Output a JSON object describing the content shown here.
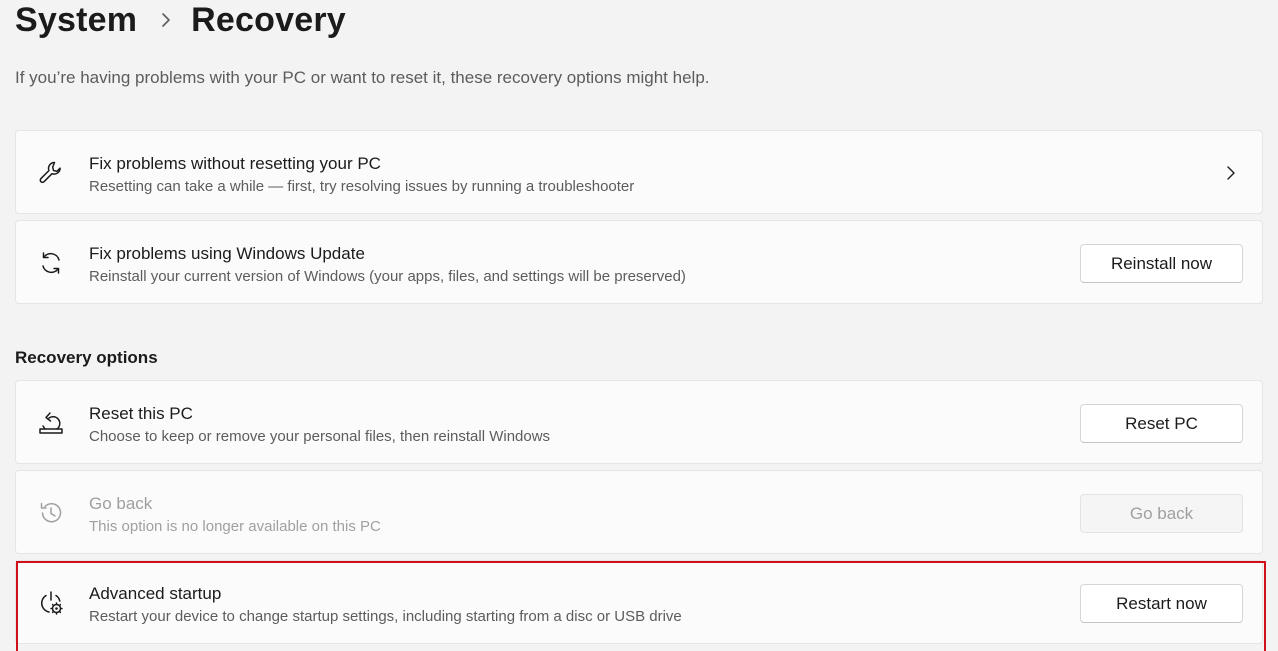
{
  "breadcrumb": {
    "parent": "System",
    "current": "Recovery"
  },
  "subtitle": "If you’re having problems with your PC or want to reset it, these recovery options might help.",
  "cards": [
    {
      "title": "Fix problems without resetting your PC",
      "description": "Resetting can take a while — first, try resolving issues by running a troubleshooter",
      "icon": "wrench-icon",
      "action": "chevron-right-icon"
    },
    {
      "title": "Fix problems using Windows Update",
      "description": "Reinstall your current version of Windows (your apps, files, and settings will be preserved)",
      "icon": "sync-icon",
      "button": "Reinstall now"
    }
  ],
  "recovery_options": {
    "heading": "Recovery options",
    "items": [
      {
        "title": "Reset this PC",
        "description": "Choose to keep or remove your personal files, then reinstall Windows",
        "icon": "reset-pc-icon",
        "button": "Reset PC",
        "enabled": true
      },
      {
        "title": "Go back",
        "description": "This option is no longer available on this PC",
        "icon": "history-icon",
        "button": "Go back",
        "enabled": false
      },
      {
        "title": "Advanced startup",
        "description": "Restart your device to change startup settings, including starting from a disc or USB drive",
        "icon": "power-gear-icon",
        "button": "Restart now",
        "enabled": true,
        "highlighted": true
      }
    ]
  },
  "colors": {
    "background": "#f3f3f3",
    "card": "#fbfbfb",
    "highlight": "#d10f1a",
    "disabled_text": "#a0a0a0"
  }
}
